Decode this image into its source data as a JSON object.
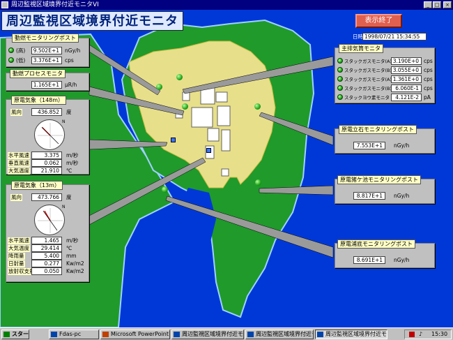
{
  "window": {
    "title": "周辺監視区域境界付近モニタVI"
  },
  "header": {
    "title": "周辺監視区域境界付近モニタ",
    "end_button": "表示終了",
    "datetime_label": "日時",
    "datetime": "1998/07/21 15:34:55"
  },
  "monitoring_post": {
    "title": "動燃モニタリングポスト",
    "rows": [
      {
        "label": "(高)",
        "value": "9.502E+1",
        "unit": "nGy/h"
      },
      {
        "label": "(低)",
        "value": "3.376E+1",
        "unit": "cps"
      }
    ]
  },
  "process_monitor": {
    "title": "動燃プロセスモニタ",
    "value": "1.165E+1",
    "unit": "μR/h"
  },
  "weather148": {
    "title": "原電気象（148m）",
    "dir_label": "風向",
    "dir_value": "436.852",
    "dir_unit": "度",
    "rows": [
      {
        "label": "水平風速",
        "value": "3.375",
        "unit": "m/秒"
      },
      {
        "label": "垂直風速",
        "value": "0.062",
        "unit": "m/秒"
      },
      {
        "label": "大気温度",
        "value": "21.910",
        "unit": "℃"
      }
    ],
    "compass_n": "N",
    "compass_deg": 315
  },
  "weather13": {
    "title": "原電気象（13m）",
    "dir_label": "風向",
    "dir_value": "473.766",
    "dir_unit": "度",
    "rows": [
      {
        "label": "水平風速",
        "value": "1.465",
        "unit": "m/秒"
      },
      {
        "label": "大気温度",
        "value": "29.414",
        "unit": "℃"
      },
      {
        "label": "降雨量",
        "value": "5.400",
        "unit": "mm"
      },
      {
        "label": "日射量",
        "value": "0.277",
        "unit": "Kw/m2"
      },
      {
        "label": "放射収支量",
        "value": "0.050",
        "unit": "Kw/m2"
      }
    ],
    "compass_n": "N",
    "compass_deg": 330
  },
  "exhaust": {
    "title": "主排気筒モニタ",
    "rows": [
      {
        "label": "スタックガスモニタ(A)",
        "value": "3.190E+0",
        "unit": "cps"
      },
      {
        "label": "スタックガスモニタ(B)",
        "value": "3.055E+0",
        "unit": "cps"
      },
      {
        "label": "スタックガスモニタ(A)",
        "value": "1.361E+0",
        "unit": "cps"
      },
      {
        "label": "スタックガスモニタ(B)",
        "value": "6.060E-1",
        "unit": "cps"
      },
      {
        "label": "スタックヨウ素モニタ",
        "value": "4.121E-2",
        "unit": "pA"
      }
    ]
  },
  "post_tateishi": {
    "title": "原電立石モニタリングポスト",
    "value": "7.553E+1",
    "unit": "nGy/h"
  },
  "post_igagaike": {
    "title": "原電猪ケ池モニタリングポスト",
    "value": "8.817E+1",
    "unit": "nGy/h"
  },
  "post_urasoko": {
    "title": "原電浦底モニタリングポスト",
    "value": "8.691E+1",
    "unit": "nGy/h"
  },
  "taskbar": {
    "start": "スタート",
    "items": [
      "Fdas-pc",
      "Microsoft PowerPoint - [...",
      "周辺監視区域境界付近モニタ",
      "周辺監視区域境界付近モ...",
      "周辺監視区域境界付近モニタ"
    ],
    "clock": "15:30"
  },
  "colors": {
    "sea": "#0038d8",
    "land": "#1f9a2b",
    "zone": "#e8df8a",
    "panel": "#c0c0c0",
    "label_bg": "#ffffc6"
  }
}
